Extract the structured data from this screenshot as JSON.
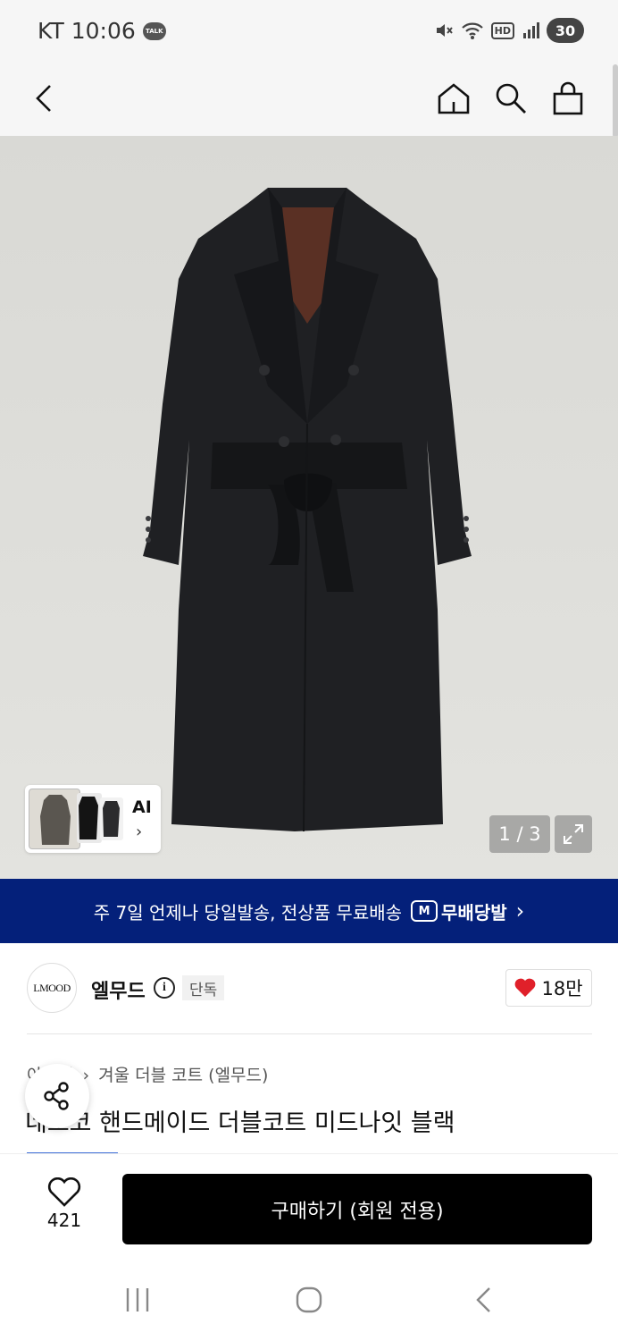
{
  "status_bar": {
    "carrier": "KT",
    "time": "10:06",
    "talk_badge": "TALK",
    "battery_level": "30",
    "hd_label": "HD"
  },
  "header": {
    "icons": [
      "back-icon",
      "home-icon",
      "search-icon",
      "shopping-bag-icon"
    ]
  },
  "gallery": {
    "pager": "1 / 3",
    "ai_label": "AI",
    "ai_chevron": "›",
    "current_index": 1,
    "total_images": 3
  },
  "shipping_banner": {
    "text": "주 7일 언제나 당일발송, 전상품 무료배송",
    "badge_icon": "M",
    "badge_label": "무배당발",
    "chevron": "›"
  },
  "brand": {
    "logo_text": "LMOOD",
    "name": "엘무드",
    "info_icon": "i",
    "exclusive_label": "단독",
    "likes": "18만"
  },
  "product": {
    "breadcrumb_hidden": "아우터",
    "breadcrumb_sep": "›",
    "breadcrumb_category": "겨울 더블 코트 (엘무드)",
    "title": "네오코 핸드메이드 더블코트 미드나잇 블랙"
  },
  "bottom_bar": {
    "wish_count": "421",
    "buy_label": "구매하기 (회원 전용)"
  },
  "colors": {
    "banner_bg": "#04207a",
    "buy_bg": "#000000",
    "heart": "#e0202a",
    "hero_bg": "#e0e0dc",
    "coat": "#1e1f22"
  }
}
